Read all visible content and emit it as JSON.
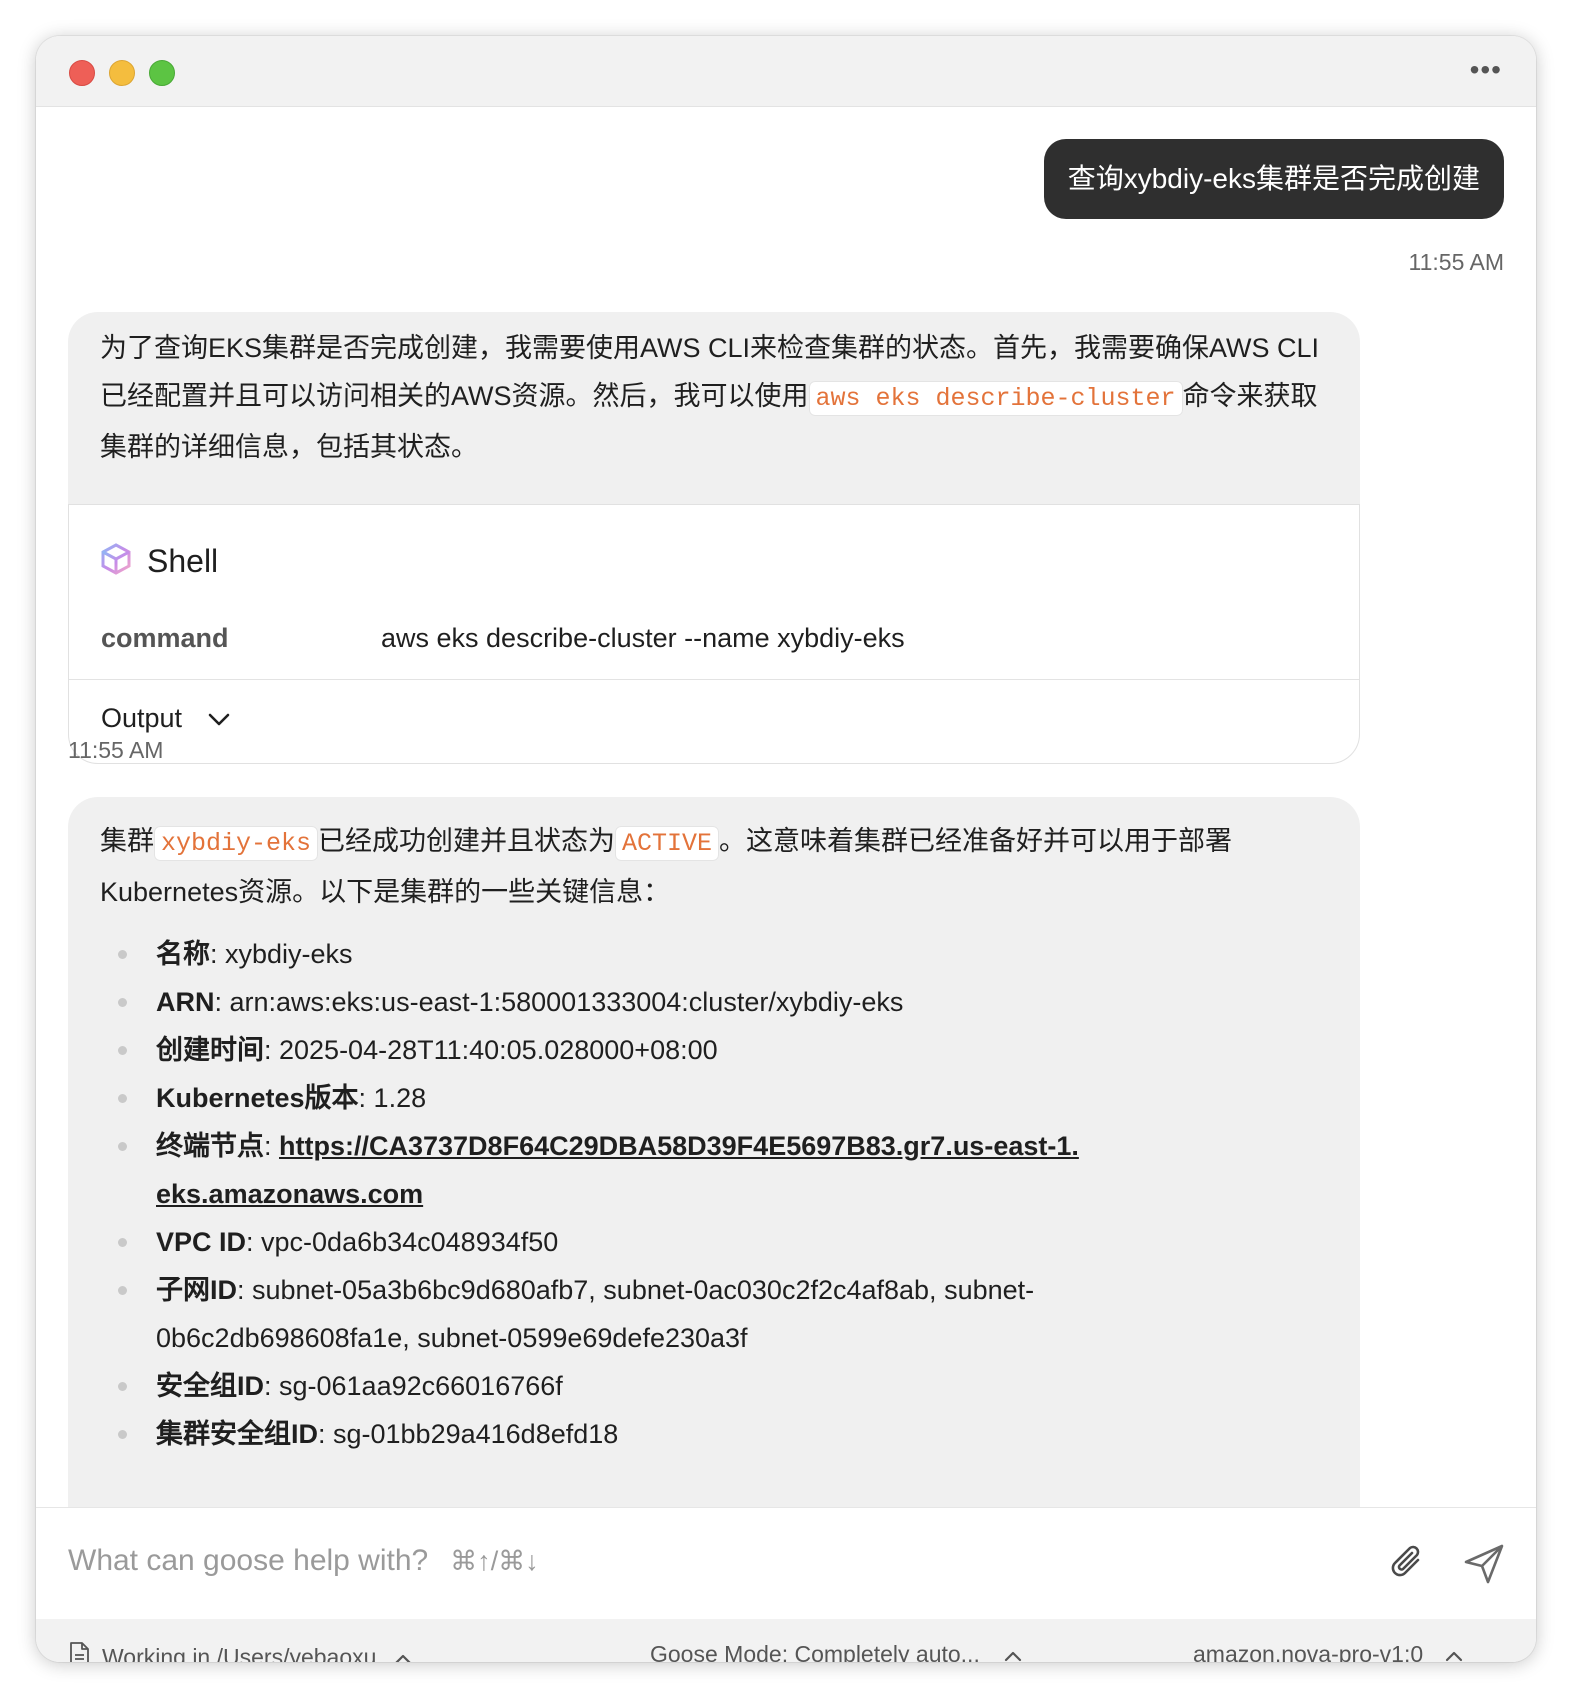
{
  "window": {
    "more_label": "•••"
  },
  "user_message": {
    "text": "查询xybdiy-eks集群是否完成创建",
    "time": "11:55 AM"
  },
  "assistant_message_1": {
    "text_before": "为了查询EKS集群是否完成创建，我需要使用AWS CLI来检查集群的状态。首先，我需要确保AWS CLI已经配置并且可以访问相关的AWS资源。然后，我可以使用",
    "code": "aws eks describe-cluster",
    "text_after": "命令来获取集群的详细信息，包括其状态。",
    "time": "11:55 AM"
  },
  "tool_call": {
    "icon": "cube-icon",
    "name": "Shell",
    "param_key": "command",
    "param_value": "aws eks describe-cluster --name xybdiy-eks",
    "output_label": "Output"
  },
  "assistant_message_2": {
    "intro_1": "集群",
    "cluster_code": "xybdiy-eks",
    "intro_2": "已经成功创建并且状态为",
    "status_code": "ACTIVE",
    "intro_3": "。这意味着集群已经准备好并可以用于部署Kubernetes资源。以下是集群的一些关键信息：",
    "items": [
      {
        "label": "名称",
        "value": ": xybdiy-eks"
      },
      {
        "label": "ARN",
        "value": ": arn:aws:eks:us-east-1:580001333004:cluster/xybdiy-eks"
      },
      {
        "label": "创建时间",
        "value": ": 2025-04-28T11:40:05.028000+08:00"
      },
      {
        "label": "Kubernetes版本",
        "value": ": 1.28"
      },
      {
        "label": "终端节点",
        "value": ": ",
        "link": "https://CA3737D8F64C29DBA58D39F4E5697B83.gr7.us-east-1.eks.amazonaws.com"
      },
      {
        "label": "VPC ID",
        "value": ": vpc-0da6b34c048934f50"
      },
      {
        "label": "子网ID",
        "value": ": subnet-05a3b6bc9d680afb7, subnet-0ac030c2f2c4af8ab, subnet-0b6c2db698608fa1e, subnet-0599e69defe230a3f"
      },
      {
        "label": "安全组ID",
        "value": ": sg-061aa92c66016766f"
      },
      {
        "label": "集群安全组ID",
        "value": ": sg-01bb29a416d8efd18"
      }
    ]
  },
  "composer": {
    "placeholder": "What can goose help with?",
    "shortcut_hint": "⌘↑/⌘↓"
  },
  "footer": {
    "working_dir": "Working in /Users/yebaoxu",
    "mode": "Goose Mode: Completely auto...",
    "model": "amazon.nova-pro-v1:0"
  },
  "colors": {
    "code_accent": "#e3733a",
    "user_bubble": "#2f2f2f",
    "assistant_bubble": "#f0f0f0"
  }
}
